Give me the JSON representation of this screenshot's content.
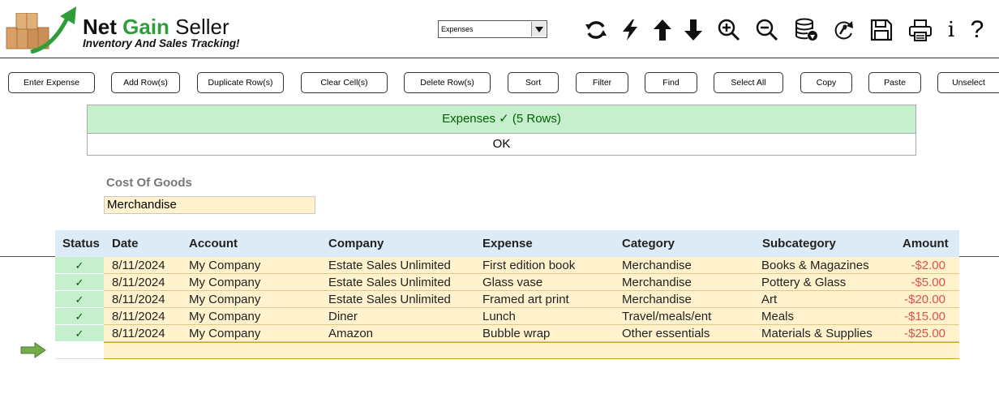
{
  "app": {
    "logo_word1": "Net",
    "logo_word2": "Gain",
    "logo_word3": "Seller",
    "tagline": "Inventory And Sales Tracking!",
    "accent": "#2f9e3a"
  },
  "view_select": {
    "value": "Expenses"
  },
  "toolbar_icons": [
    "refresh-icon",
    "lightning-icon",
    "arrow-up-icon",
    "arrow-down-icon",
    "zoom-in-icon",
    "zoom-out-icon",
    "database-download-icon",
    "sync-icon",
    "save-icon",
    "print-icon",
    "info-icon",
    "help-icon"
  ],
  "info_glyph": "i",
  "help_glyph": "?",
  "buttons": {
    "enter_expense": "Enter Expense",
    "add_rows": "Add Row(s)",
    "duplicate_rows": "Duplicate Row(s)",
    "clear_cells": "Clear Cell(s)",
    "delete_rows": "Delete Row(s)",
    "sort": "Sort",
    "filter": "Filter",
    "find": "Find",
    "select_all": "Select All",
    "copy": "Copy",
    "paste": "Paste",
    "unselect": "Unselect"
  },
  "banner": {
    "text": "Expenses ✓ (5 Rows)",
    "ok": "OK",
    "color": "#c6efce"
  },
  "filter": {
    "label": "Cost Of Goods",
    "value": "Merchandise"
  },
  "table": {
    "columns": {
      "status": "Status",
      "date": "Date",
      "account": "Account",
      "company": "Company",
      "expense": "Expense",
      "category": "Category",
      "subcategory": "Subcategory",
      "amount": "Amount"
    },
    "rows": [
      {
        "status": "✓",
        "date": "8/11/2024",
        "account": "My Company",
        "company": "Estate Sales Unlimited",
        "expense": "First edition book",
        "category": "Merchandise",
        "subcategory": "Books & Magazines",
        "amount": "-$2.00"
      },
      {
        "status": "✓",
        "date": "8/11/2024",
        "account": "My Company",
        "company": "Estate Sales Unlimited",
        "expense": "Glass vase",
        "category": "Merchandise",
        "subcategory": "Pottery & Glass",
        "amount": "-$5.00"
      },
      {
        "status": "✓",
        "date": "8/11/2024",
        "account": "My Company",
        "company": "Estate Sales Unlimited",
        "expense": "Framed art print",
        "category": "Merchandise",
        "subcategory": "Art",
        "amount": "-$20.00"
      },
      {
        "status": "✓",
        "date": "8/11/2024",
        "account": "My Company",
        "company": "Diner",
        "expense": "Lunch",
        "category": "Travel/meals/ent",
        "subcategory": "Meals",
        "amount": "-$15.00"
      },
      {
        "status": "✓",
        "date": "8/11/2024",
        "account": "My Company",
        "company": "Amazon",
        "expense": "Bubble wrap",
        "category": "Other essentials",
        "subcategory": "Materials & Supplies",
        "amount": "-$25.00"
      }
    ],
    "amount_color": "#d9534f"
  }
}
